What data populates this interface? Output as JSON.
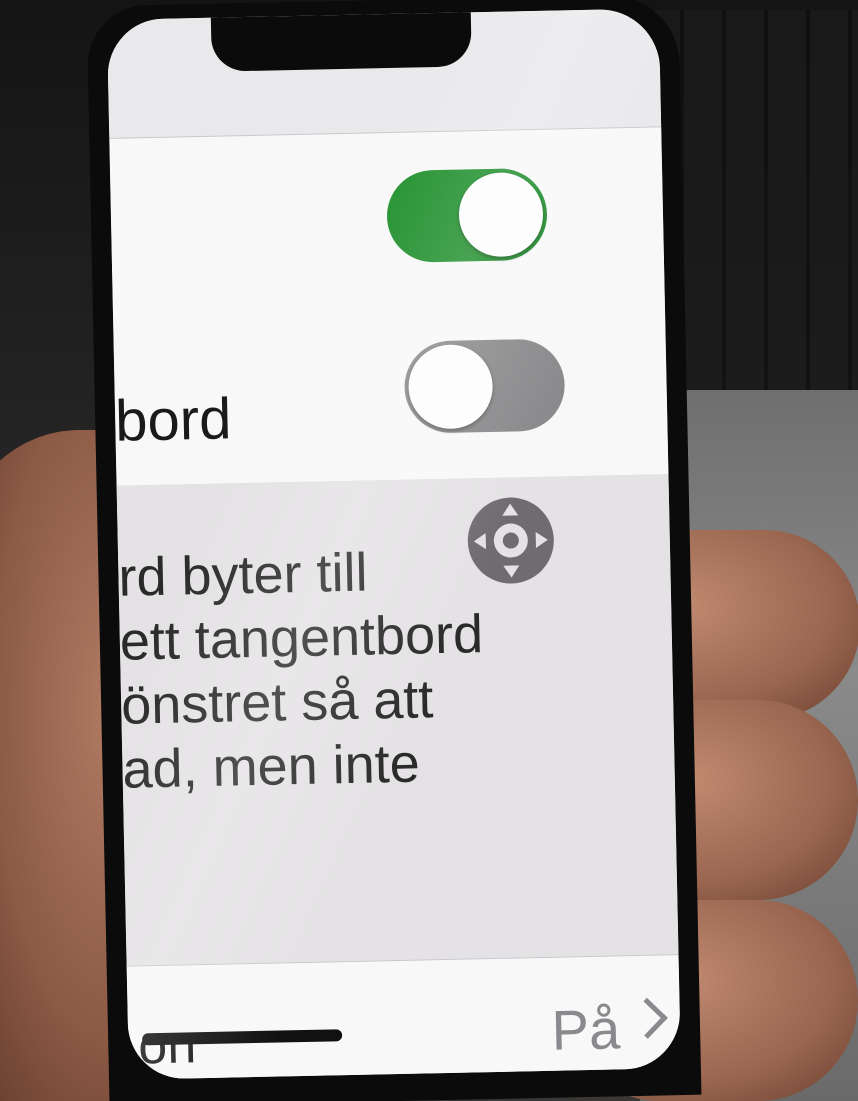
{
  "settings": {
    "row1": {
      "toggle_state": "on",
      "toggle_color": "#1f8f2c"
    },
    "row2": {
      "label": "bord",
      "toggle_state": "off",
      "toggle_color": "#8a8a8c"
    },
    "description": {
      "icon": "move-arrows-icon",
      "lines": [
        "rd byter till",
        " ett tangentbord",
        "önstret så att",
        "ad, men inte"
      ]
    },
    "bottom_row": {
      "label": "on",
      "value": "På",
      "icon": "chevron-right-icon"
    }
  }
}
